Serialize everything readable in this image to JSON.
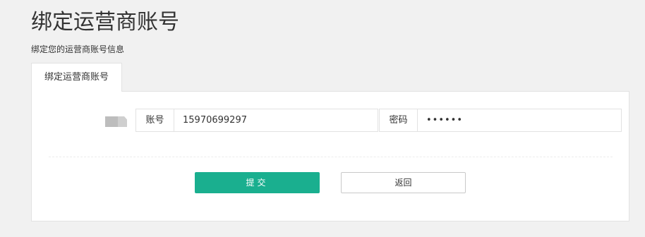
{
  "header": {
    "title": "绑定运营商账号",
    "subtitle": "绑定您的运营商账号信息"
  },
  "tabs": [
    {
      "label": "绑定运营商账号",
      "active": true
    }
  ],
  "form": {
    "carrier_icon": "carrier-logo-icon",
    "account": {
      "label": "账号",
      "value": "15970699297"
    },
    "password": {
      "label": "密码",
      "value": "123456"
    },
    "submit_label": "提交",
    "back_label": "返回"
  },
  "colors": {
    "primary": "#1aaf8f",
    "background": "#f1f1f1",
    "border": "#e2e2e2"
  }
}
